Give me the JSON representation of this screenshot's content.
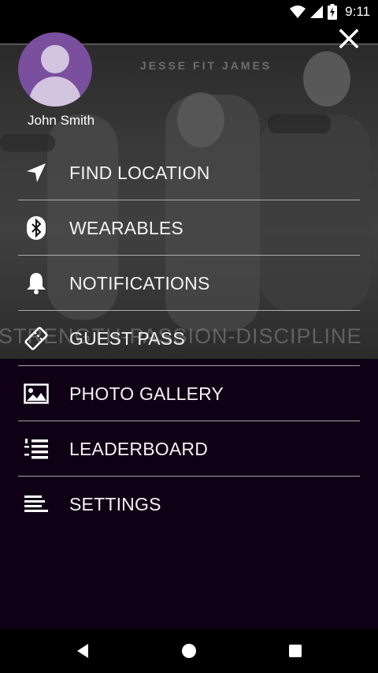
{
  "status_bar": {
    "time": "9:11",
    "icons": [
      "wifi-icon",
      "signal-icon",
      "battery-charging-icon"
    ]
  },
  "hero": {
    "brand_text": "JESSE FIT JAMES",
    "watermark_text": "STRENGTH-PASSION-DISCIPLINE"
  },
  "drawer": {
    "close_icon": "close-icon",
    "user": {
      "name": "John Smith",
      "avatar_icon": "person-icon"
    },
    "menu": [
      {
        "label": "FIND LOCATION",
        "icon": "location-arrow-icon"
      },
      {
        "label": "WEARABLES",
        "icon": "bluetooth-icon"
      },
      {
        "label": "NOTIFICATIONS",
        "icon": "bell-icon"
      },
      {
        "label": "GUEST PASS",
        "icon": "ticket-icon"
      },
      {
        "label": "PHOTO GALLERY",
        "icon": "image-icon"
      },
      {
        "label": "LEADERBOARD",
        "icon": "numbered-list-icon"
      },
      {
        "label": "SETTINGS",
        "icon": "menu-lines-icon"
      }
    ]
  },
  "nav_bar": {
    "icons": [
      "back-icon",
      "home-icon",
      "recents-icon"
    ]
  },
  "colors": {
    "panel": "#0f0015",
    "avatar": "#7a4f9e",
    "text": "#f2f2f2"
  }
}
